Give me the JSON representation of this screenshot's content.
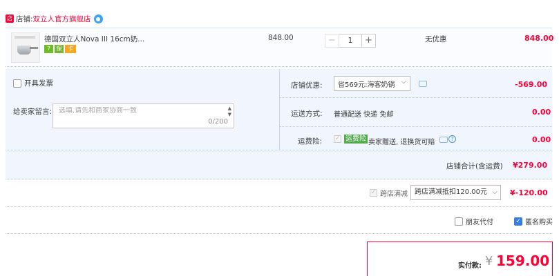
{
  "shop": {
    "prefix": "店铺:",
    "name": "双立人官方旗舰店",
    "icon": "shop-icon",
    "contact_icon": "wangwang-icon"
  },
  "item": {
    "title": "德国双立人Nova III 16cm奶...",
    "price": "848.00",
    "quantity": "1",
    "minus": "−",
    "plus": "+",
    "promo": "无优惠",
    "subtotal": "848.00",
    "badges": [
      "7",
      "保",
      "卡"
    ]
  },
  "invoice": {
    "label": "开具发票"
  },
  "message": {
    "label": "给卖家留言:",
    "placeholder": "选填,请先和商家协商一致",
    "count": "0/200"
  },
  "shop_discount": {
    "label": "店铺优惠:",
    "selected": "省569元:海客奶锅",
    "value": "-569.00"
  },
  "shipping": {
    "label": "运送方式:",
    "method": "普通配送 快递 免邮",
    "value": "0.00"
  },
  "insurance": {
    "label": "运费险:",
    "tag": "运费险",
    "text": "卖家赠送, 退换货可赔",
    "help": "?",
    "value": "0.00"
  },
  "shop_total": {
    "label": "店铺合计(含运费)",
    "value": "¥279.00"
  },
  "cross_shop": {
    "label": "跨店满减",
    "selected": "跨店满减抵扣120.00元",
    "value": "¥-120.00"
  },
  "friend_pay": {
    "label": "朋友代付"
  },
  "anonymous": {
    "label": "匿名购买",
    "checked": true
  },
  "payment": {
    "label": "实付款:",
    "currency": "¥",
    "amount": "159.00"
  },
  "colors": {
    "accent": "#ff0036",
    "panel": "#f1f6fe"
  }
}
